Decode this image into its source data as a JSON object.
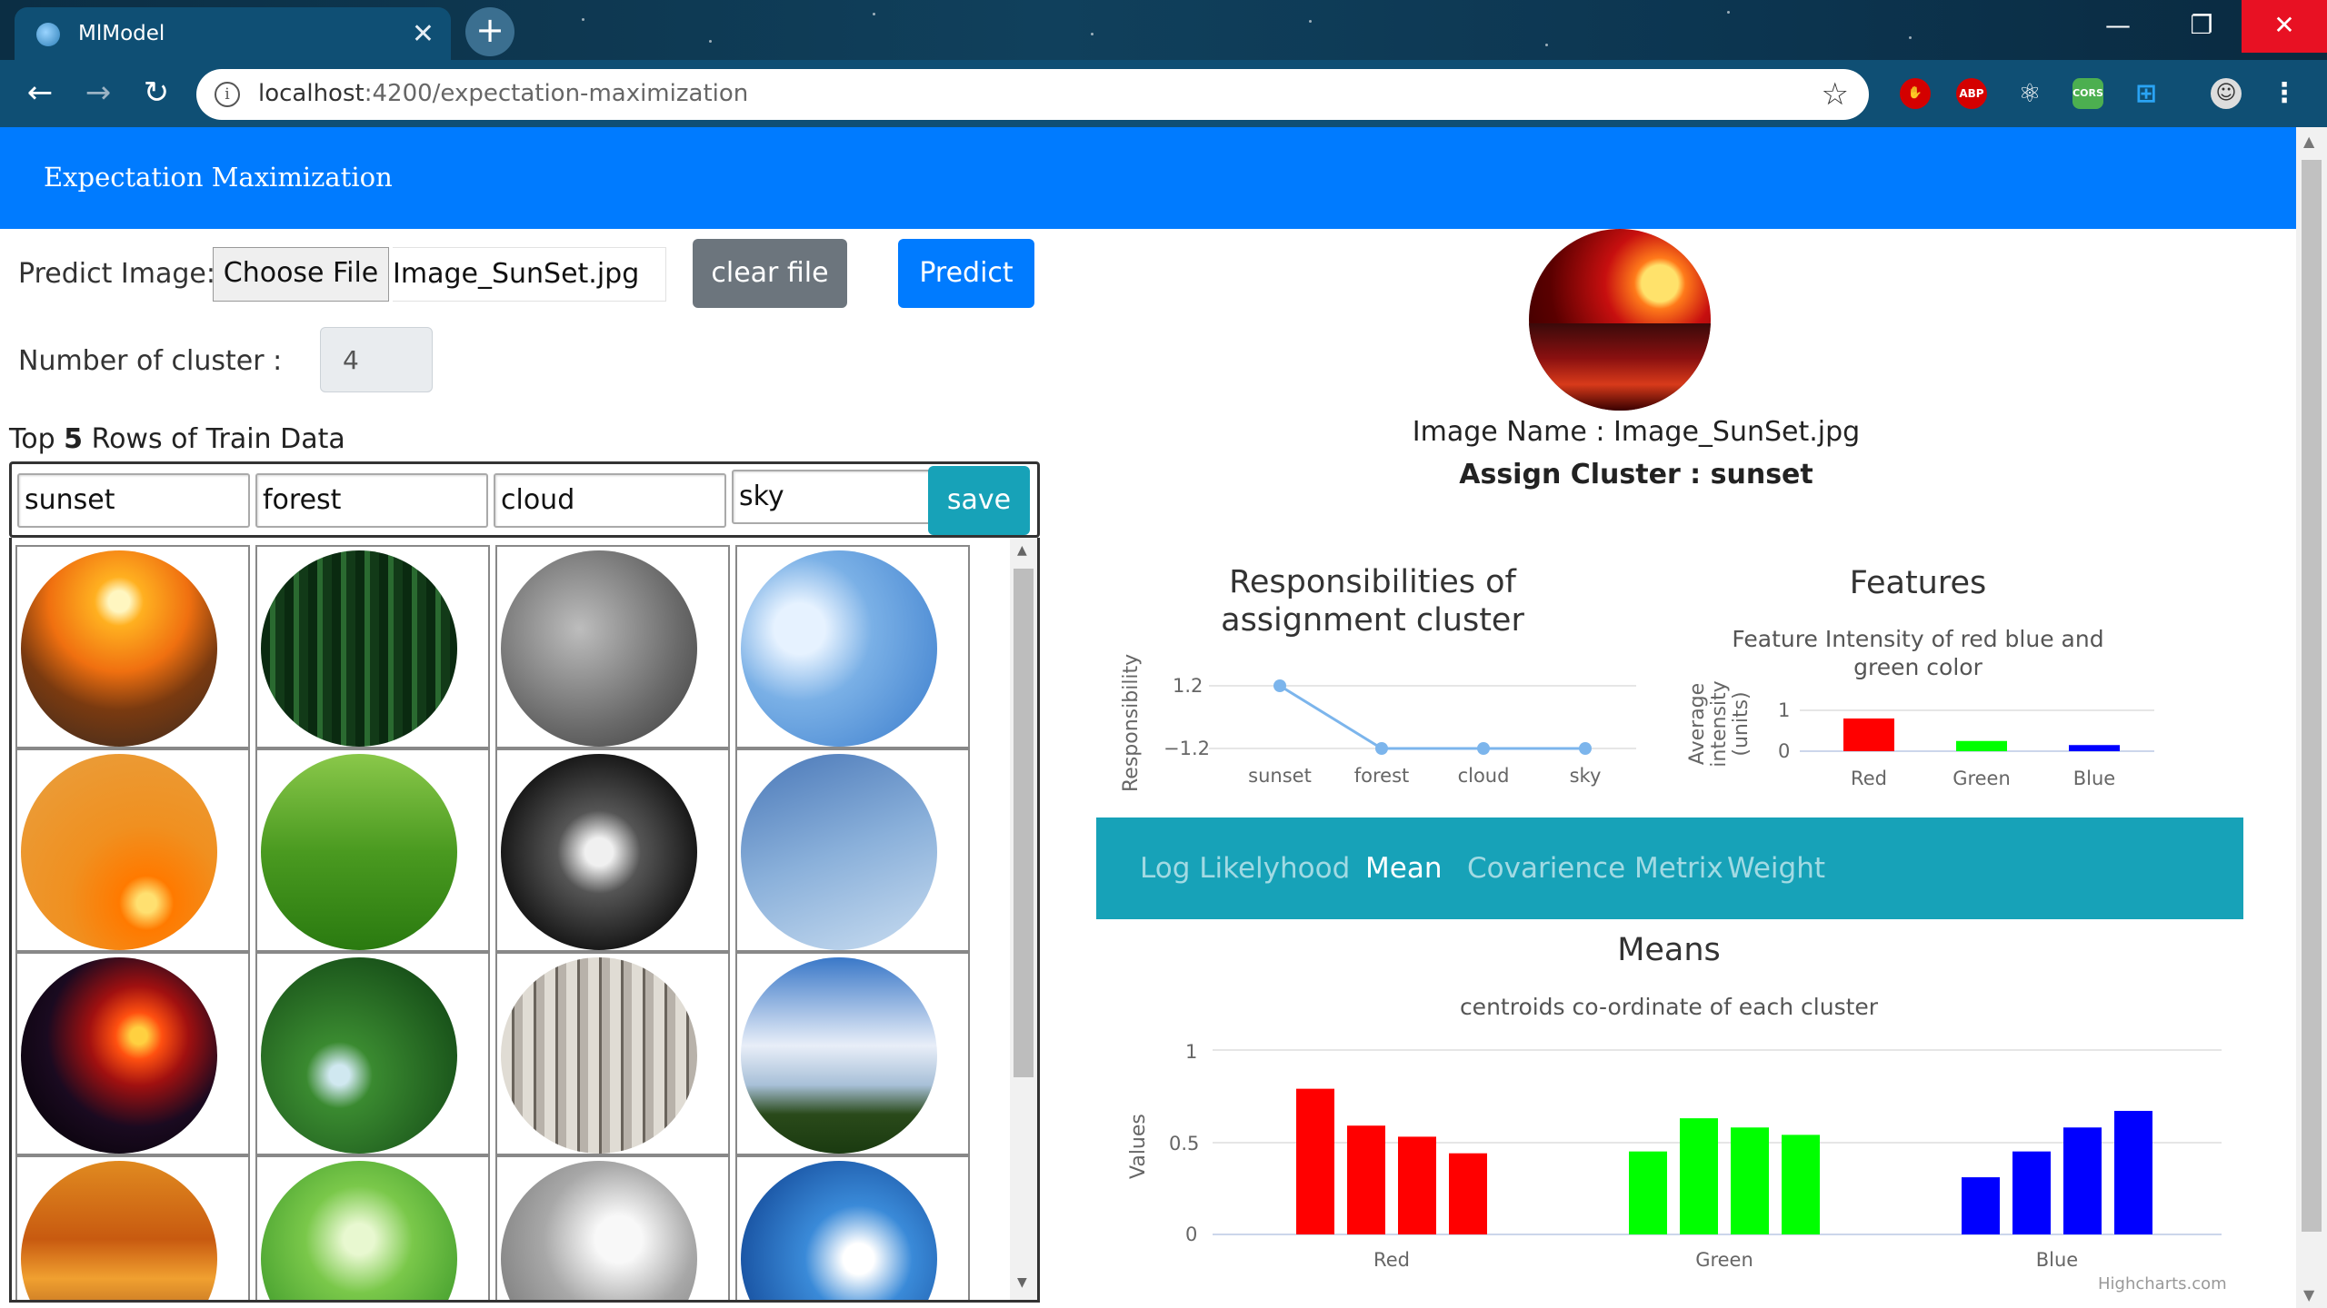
{
  "browser": {
    "tab_title": "MlModel",
    "url_host": "localhost",
    "url_rest": ":4200/expectation-maximization"
  },
  "app": {
    "title": "Expectation Maximization"
  },
  "form": {
    "predict_label": "Predict Image:",
    "choose_file_label": "Choose File",
    "file_name": "Image_SunSet.jpg",
    "clear_label": "clear file",
    "predict_button": "Predict",
    "cluster_label": "Number of cluster :",
    "cluster_value": "4"
  },
  "train": {
    "heading_pre": "Top ",
    "heading_bold": "5",
    "heading_post": " Rows of Train Data",
    "labels": [
      "sunset",
      "forest",
      "cloud",
      "sky"
    ],
    "save_label": "save"
  },
  "prediction": {
    "image_name_text": "Image Name : Image_SunSet.jpg",
    "assign_text": "Assign Cluster : sunset"
  },
  "chart_data": [
    {
      "type": "line",
      "title": "Responsibilities of assignment cluster",
      "ylabel": "Responsibility",
      "categories": [
        "sunset",
        "forest",
        "cloud",
        "sky"
      ],
      "series": [
        {
          "values": [
            1.2,
            -1.2,
            -1.2,
            -1.2
          ]
        }
      ],
      "y_ticks": [
        "1.2",
        "−1.2"
      ],
      "color": "#7cb5ec"
    },
    {
      "type": "bar",
      "title": "Features",
      "subtitle": "Feature Intensity of red blue and green color",
      "ylabel": "Average intensity (units)",
      "categories": [
        "Red",
        "Green",
        "Blue"
      ],
      "values": [
        0.8,
        0.25,
        0.15
      ],
      "colors": [
        "#ff0000",
        "#00ff00",
        "#0000ff"
      ],
      "y_ticks": [
        "0",
        "1"
      ],
      "ylim": [
        0,
        1
      ]
    },
    {
      "type": "bar",
      "title": "Means",
      "subtitle": "centroids co-ordinate of each cluster",
      "ylabel": "Values",
      "categories": [
        "Red",
        "Green",
        "Blue"
      ],
      "series": [
        {
          "values": [
            0.79,
            0.45,
            0.31
          ]
        },
        {
          "values": [
            0.59,
            0.63,
            0.45
          ]
        },
        {
          "values": [
            0.53,
            0.58,
            0.58
          ]
        },
        {
          "values": [
            0.44,
            0.54,
            0.67
          ]
        }
      ],
      "colors": [
        "#ff0000",
        "#00ff00",
        "#0000ff"
      ],
      "y_ticks": [
        "0",
        "0.5",
        "1"
      ],
      "ylim": [
        0,
        1
      ],
      "credits": "Highcharts.com"
    }
  ],
  "tabs": [
    "Log Likelyhood",
    "Mean",
    "Covarience Metrix",
    "Weight"
  ],
  "active_tab": "Mean"
}
